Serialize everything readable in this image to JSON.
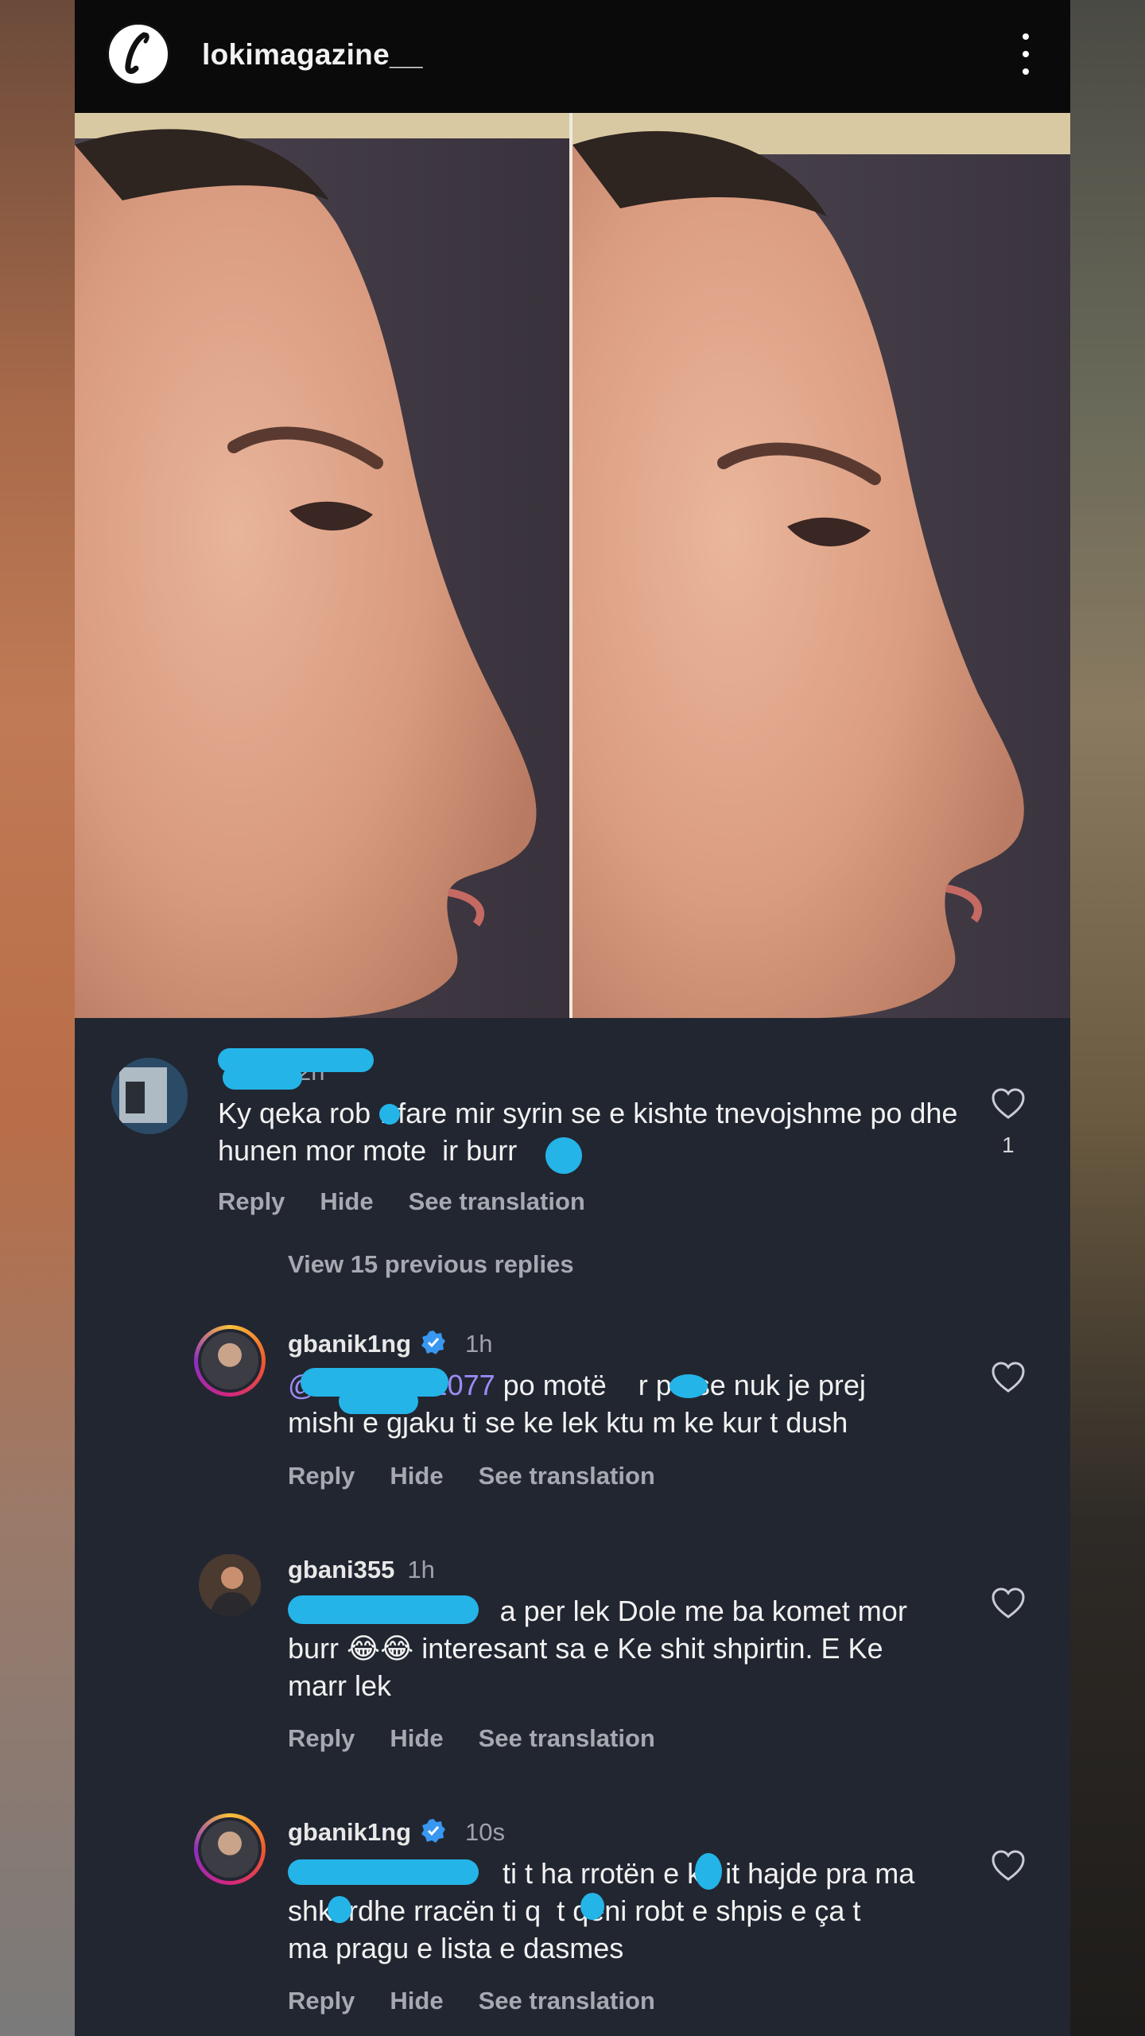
{
  "header": {
    "logo_letter": "l",
    "username": "lokimagazine__",
    "more_icon": "more-vertical-icon"
  },
  "comments": [
    {
      "username": "",
      "time": "2h",
      "text_before": "Ky qeka rob",
      "text_mid": "r fare mir syrin se e kishte tnevojshme po dhe hunen mor mote",
      "text_after": "ir burr",
      "likes": "1",
      "actions": [
        "Reply",
        "Hide",
        "See translation"
      ]
    }
  ],
  "view_replies": "View 15 previous replies",
  "replies": [
    {
      "username": "gbanik1ng",
      "verified": true,
      "time": "1h",
      "mention": "7",
      "mention_prefix": "@",
      "mention_mid": "1077",
      "text_a": "po motë",
      "text_b": "r po se nuk je prej",
      "text_c": "mishi e gjaku ti se ke lek ktu m ke kur t dush",
      "actions": [
        "Reply",
        "Hide",
        "See translation"
      ]
    },
    {
      "username": "gbani355",
      "verified": false,
      "time": "1h",
      "mention": "7",
      "text_line1": "a per lek Dole me ba komet mor",
      "text_line2_a": "burr",
      "emoji": "😂😂",
      "text_line2_b": "interesant sa e Ke shit shpirtin. E Ke",
      "text_line3": "marr lek",
      "actions": [
        "Reply",
        "Hide",
        "See translation"
      ]
    },
    {
      "username": "gbanik1ng",
      "verified": true,
      "time": "10s",
      "text_line1_a": "ti t ha rrotën e k",
      "text_line1_b": "it hajde pra ma",
      "text_line2_a": "shk",
      "text_line2_b": "rdhe rracën ti q",
      "text_line2_c": "t qeni robt e shpis e ça t",
      "text_line3": "ma pragu e lista e dasmes",
      "actions": [
        "Reply",
        "Hide",
        "See translation"
      ]
    }
  ],
  "colors": {
    "background": "#222631",
    "topbar": "#0a0a0a",
    "mention": "#9b8cf6",
    "redaction": "#24b4e8",
    "verified": "#3897f0"
  }
}
